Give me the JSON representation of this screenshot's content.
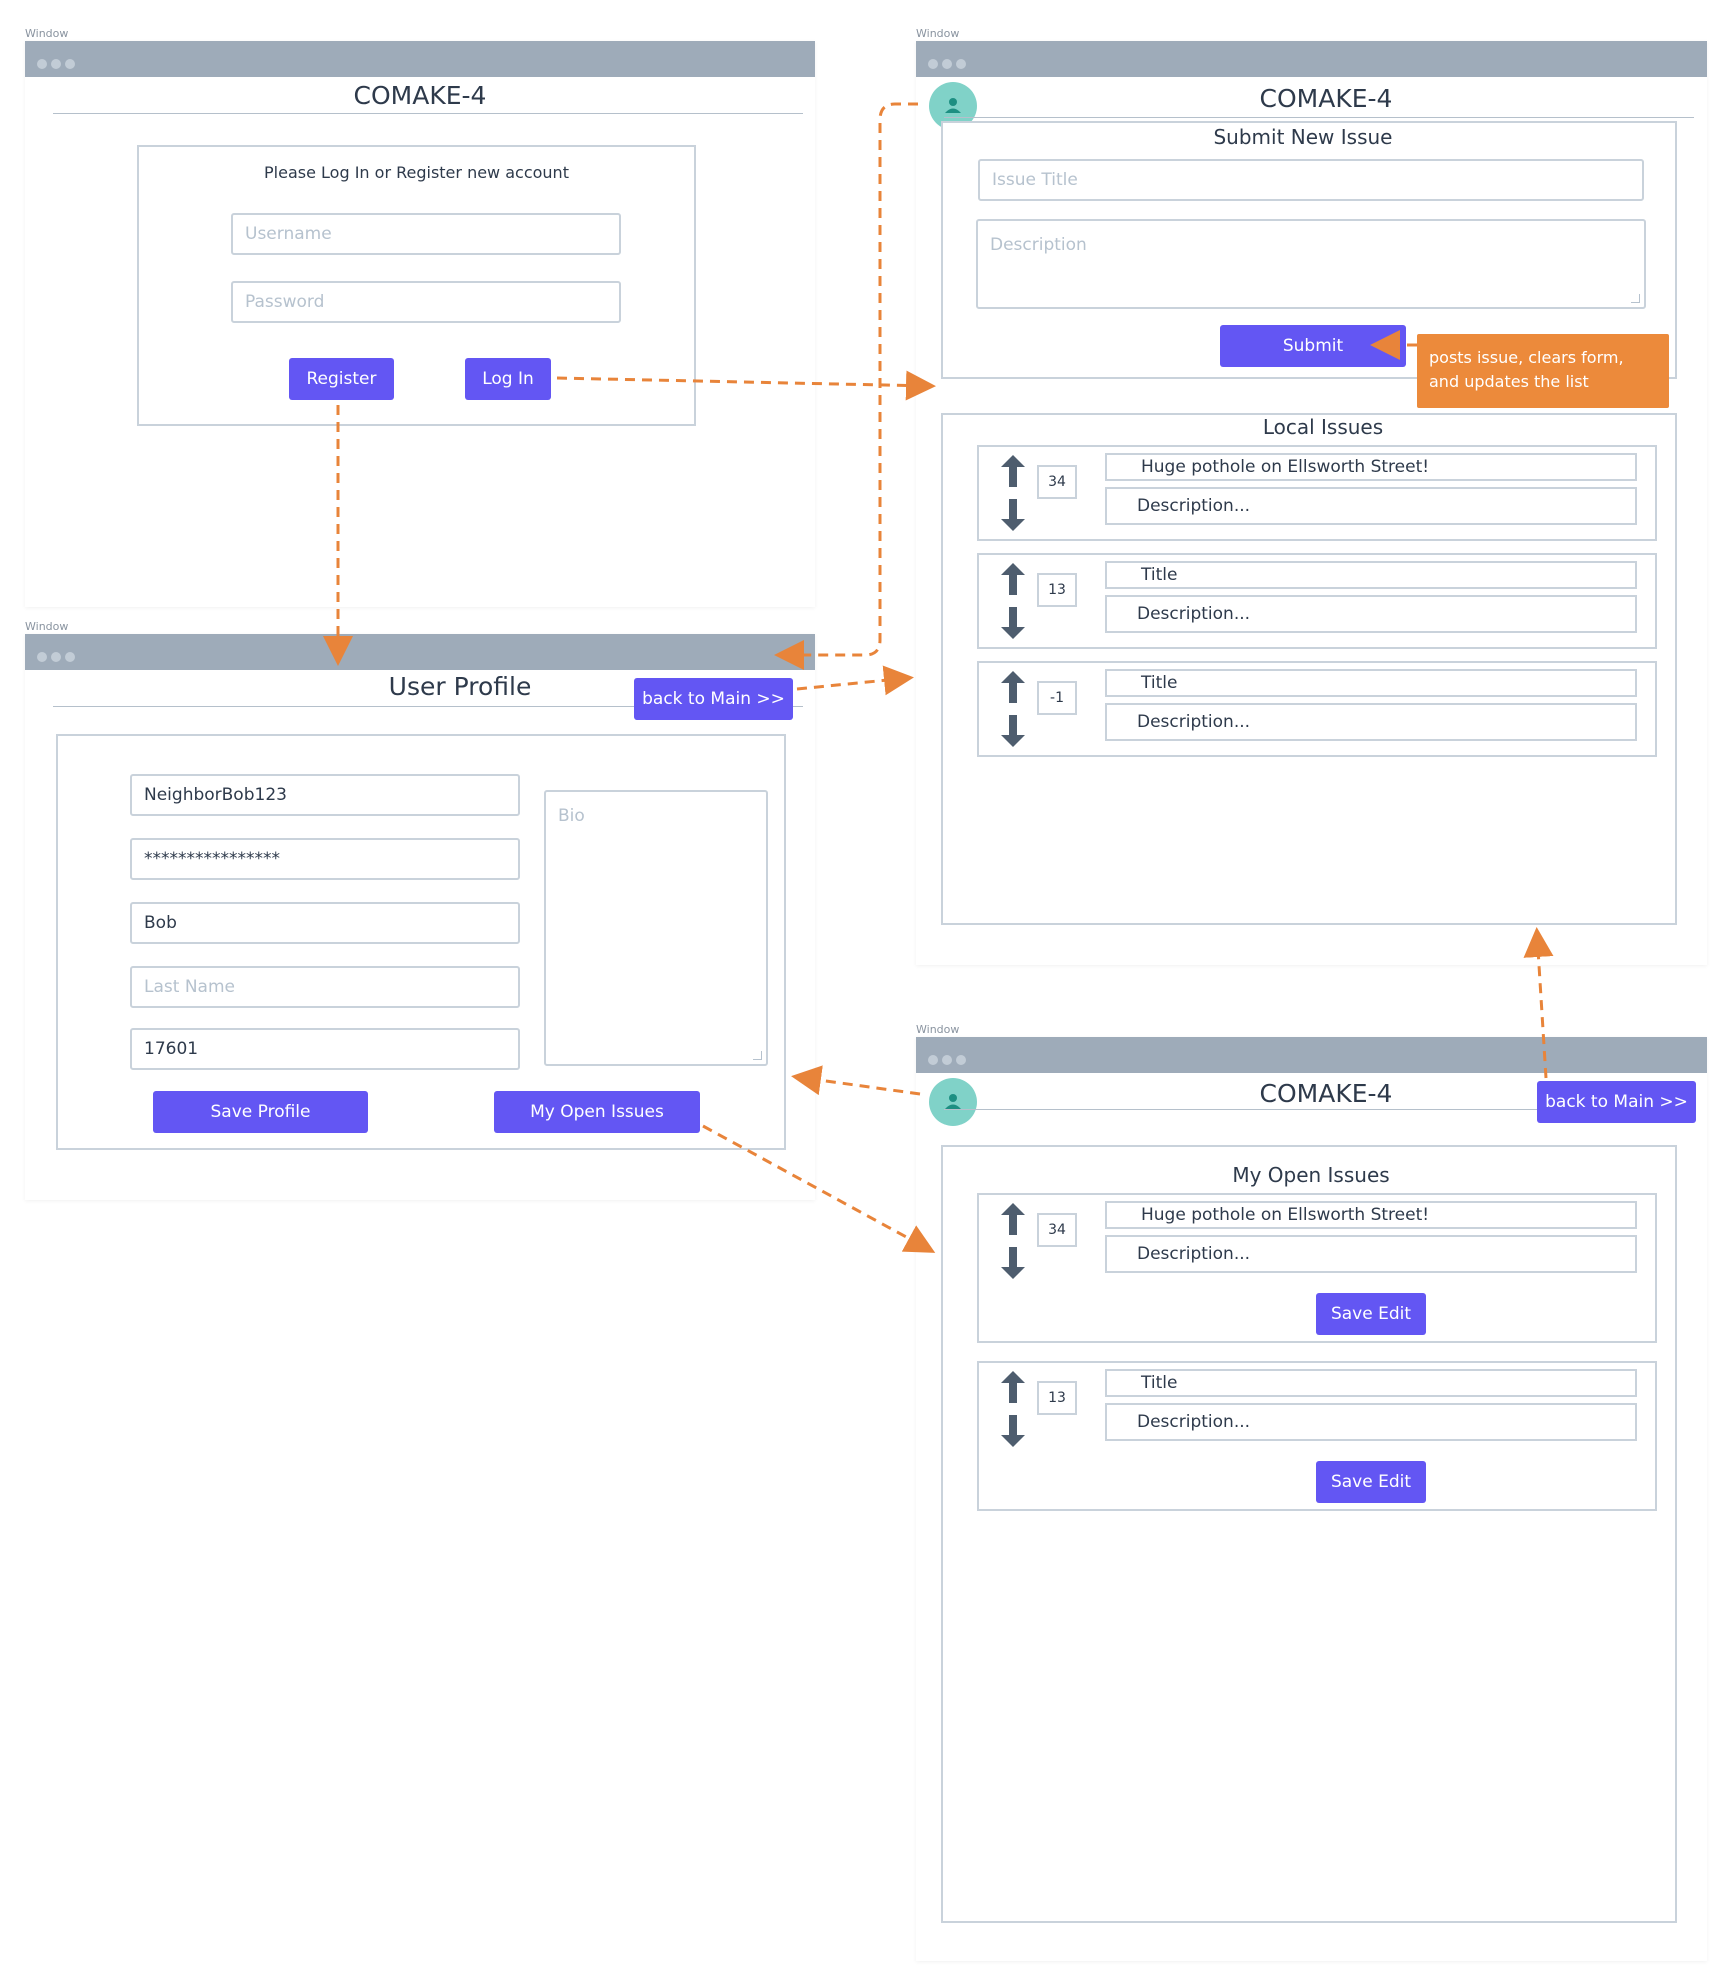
{
  "window_label": "Window",
  "login": {
    "app_title": "COMAKE-4",
    "prompt": "Please Log In or Register new account",
    "username_placeholder": "Username",
    "password_placeholder": "Password",
    "register_label": "Register",
    "login_label": "Log In"
  },
  "profile": {
    "title": "User Profile",
    "back_label": "back to Main >>",
    "username_value": "NeighborBob123",
    "password_value": "****************",
    "first_name_value": "Bob",
    "last_name_placeholder": "Last Name",
    "zip_value": "17601",
    "bio_placeholder": "Bio",
    "save_label": "Save Profile",
    "open_issues_label": "My Open Issues"
  },
  "main": {
    "app_title": "COMAKE-4",
    "submit_heading": "Submit New Issue",
    "issue_title_placeholder": "Issue Title",
    "description_placeholder": "Description",
    "submit_label": "Submit",
    "note": "posts issue, clears form, and updates the list",
    "local_heading": "Local Issues",
    "issues": [
      {
        "votes": "34",
        "title": "Huge pothole on Ellsworth Street!",
        "description": "Description..."
      },
      {
        "votes": "13",
        "title": "Title",
        "description": "Description..."
      },
      {
        "votes": "-1",
        "title": "Title",
        "description": "Description..."
      }
    ]
  },
  "my_issues": {
    "app_title": "COMAKE-4",
    "back_label": "back to Main >>",
    "heading": "My Open Issues",
    "issues": [
      {
        "votes": "34",
        "title": "Huge pothole on Ellsworth Street!",
        "description": "Description...",
        "save_label": "Save Edit"
      },
      {
        "votes": "13",
        "title": "Title",
        "description": "Description...",
        "save_label": "Save Edit"
      }
    ]
  },
  "colors": {
    "accent": "#6356f3",
    "connector": "#e8843a",
    "titlebar": "#9eabb9",
    "avatar": "#80d2c8"
  },
  "icons": [
    "up-arrow-icon",
    "down-arrow-icon",
    "user-icon",
    "window-dots-icon"
  ]
}
